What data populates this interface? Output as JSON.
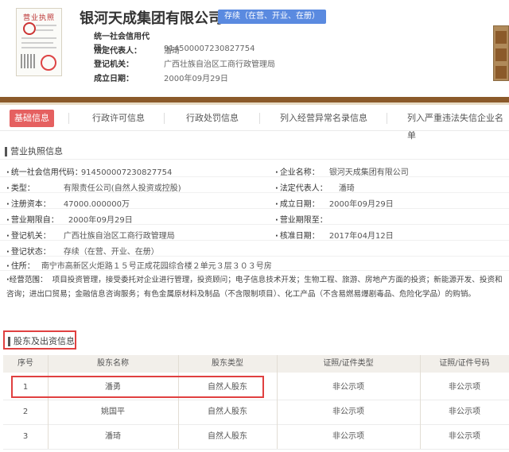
{
  "header": {
    "license_thumb_title": "营业执照",
    "company_name": "银河天成集团有限公司",
    "status_badge": "存续（在营、开业、在册）",
    "rows": [
      {
        "label": "统一社会信用代码：",
        "value": "914500007230827754"
      },
      {
        "label": "法定代表人：",
        "value": "潘琦"
      },
      {
        "label": "登记机关：",
        "value": "广西壮族自治区工商行政管理局"
      },
      {
        "label": "成立日期：",
        "value": "2000年09月29日"
      }
    ]
  },
  "tabs": [
    "基础信息",
    "行政许可信息",
    "行政处罚信息",
    "列入经营异常名录信息",
    "列入严重违法失信企业名单"
  ],
  "license_section": {
    "title": "营业执照信息",
    "left": [
      {
        "label": "统一社会信用代码：",
        "value": "914500007230827754"
      },
      {
        "label": "类型：",
        "value": "有限责任公司(自然人投资或控股)"
      },
      {
        "label": "注册资本：",
        "value": "47000.000000万"
      },
      {
        "label": "营业期限自：",
        "value": "2000年09月29日"
      },
      {
        "label": "登记机关：",
        "value": "广西壮族自治区工商行政管理局"
      },
      {
        "label": "登记状态：",
        "value": "存续（在营、开业、在册）"
      }
    ],
    "right": [
      {
        "label": "企业名称：",
        "value": "银河天成集团有限公司"
      },
      {
        "label": "法定代表人：",
        "value": "潘琦"
      },
      {
        "label": "成立日期：",
        "value": "2000年09月29日"
      },
      {
        "label": "营业期限至：",
        "value": ""
      },
      {
        "label": "核准日期：",
        "value": "2017年04月12日"
      }
    ],
    "address_label": "住所：",
    "address": "南宁市高新区火炬路１５号正成花园综合楼２单元３层３０３号房",
    "scope_label": "经营范围：",
    "scope": "项目投资管理，接受委托对企业进行管理，投资顾问；电子信息技术开发；生物工程、旅游、房地产方面的投资；新能源开发、投资和咨询；进出口贸易；金融信息咨询服务；有色金属原材料及制品（不含限制项目）、化工产品（不含易燃易爆剧毒品、危险化学品）的购销。"
  },
  "shareholder_section": {
    "title": "股东及出资信息",
    "headers": [
      "序号",
      "股东名称",
      "股东类型",
      "证照/证件类型",
      "证照/证件号码"
    ],
    "rows": [
      {
        "no": "1",
        "name": "潘勇",
        "type": "自然人股东",
        "cert_type": "非公示项",
        "cert_no": "非公示项"
      },
      {
        "no": "2",
        "name": "姚国平",
        "type": "自然人股东",
        "cert_type": "非公示项",
        "cert_no": "非公示项"
      },
      {
        "no": "3",
        "name": "潘琦",
        "type": "自然人股东",
        "cert_type": "非公示项",
        "cert_no": "非公示项"
      }
    ]
  },
  "colors": {
    "brand_brown": "#8b5a2a",
    "active_tab": "#e56060",
    "status_badge": "#5a8ae0",
    "highlight": "#e04040"
  }
}
